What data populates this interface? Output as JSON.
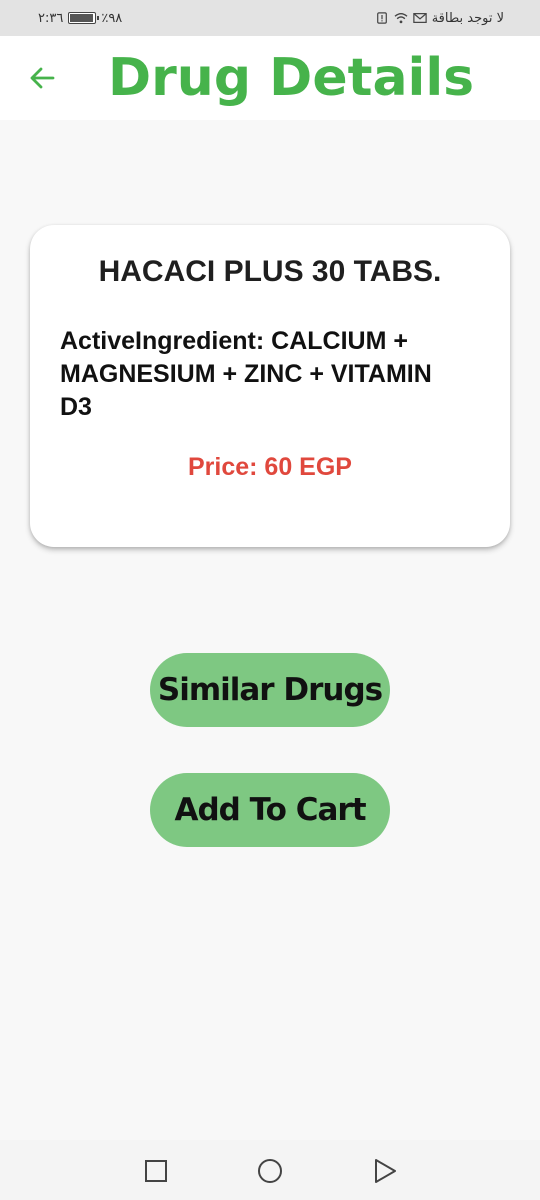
{
  "status_bar": {
    "carrier": "لا توجد بطاقة",
    "time": "٢:٣٦",
    "battery": "٪٩٨"
  },
  "app_bar": {
    "title": "Drug Details",
    "back_icon": "arrow-left-icon"
  },
  "drug": {
    "name": "HACACI PLUS 30 TABS.",
    "active_ingredient": "ActiveIngredient: CALCIUM + MAGNESIUM + ZINC + VITAMIN D3",
    "price": "Price: 60 EGP"
  },
  "actions": {
    "similar_label": "Similar Drugs",
    "cart_label": "Add To Cart"
  },
  "nav_bar": {
    "icons": [
      "square-recent-icon",
      "circle-home-icon",
      "triangle-back-icon"
    ]
  },
  "colors": {
    "title_green": "#46b34b",
    "button_green": "#7ec882",
    "price_red": "#e0483d"
  }
}
